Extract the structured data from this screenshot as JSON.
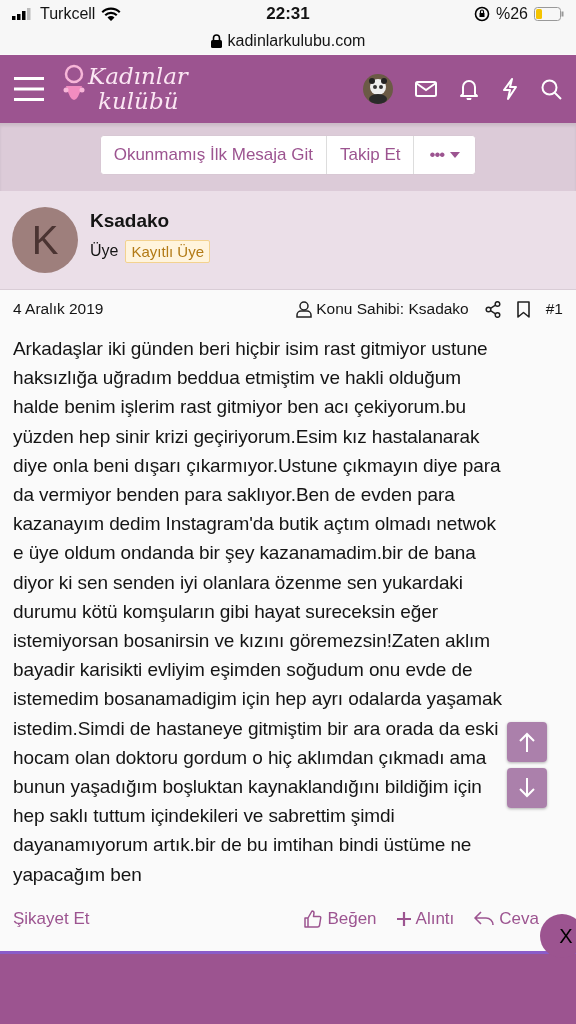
{
  "status_bar": {
    "carrier": "Turkcell",
    "time": "22:31",
    "battery": "%26"
  },
  "browser": {
    "url": "kadinlarkulubu.com"
  },
  "header": {
    "logo_top": "Kadınlar",
    "logo_bottom": "kulübü"
  },
  "thread_buttons": [
    {
      "kind": "text",
      "label": "Okunmamış İlk Mesaja Git"
    },
    {
      "kind": "text",
      "label": "Takip Et"
    },
    {
      "kind": "menu",
      "label": "•••"
    }
  ],
  "post": {
    "avatar_letter": "K",
    "username": "Ksadako",
    "role": "Üye",
    "badge": "Kayıtlı Üye",
    "date": "4 Aralık 2019",
    "owner": "Konu Sahibi: Ksadako",
    "number": "#1",
    "body": "Arkadaşlar iki günden beri hiçbir isim rast gitmiyor ustune haksızlığa uğradım beddua etmiştim ve hakli olduğum halde benim işlerim rast gitmiyor ben acı çekiyorum.bu yüzden hep sinir krizi geçiriyorum.Esim kız hastalanarak diye onla beni dışarı çıkarmıyor.Ustune çıkmayın diye para da vermiyor benden para saklıyor.Ben de evden para kazanayım dedim Instagram'da butik açtım olmadı netwok e üye oldum ondanda bir şey kazanamadim.bir de bana diyor ki sen senden iyi olanlara özenme sen yukardaki durumu kötü komşuların gibi hayat sureceksin eğer istemiyorsan bosanirsin ve kızını göremezsin!Zaten aklım bayadir karisikti evliyim eşimden soğudum onu evde de istemedim bosanamadigim için hep ayrı odalarda yaşamak istedim.Simdi de hastaneye gitmiştim bir ara orada da eski hocam olan doktoru gordum o hiç aklımdan çıkmadı ama bunun yaşadığım boşluktan kaynaklandığını bildiğim için hep saklı tuttum içindekileri ve sabrettim şimdi dayanamıyorum artık.bir de bu imtihan bindi üstüme ne yapacağım ben",
    "report": "Şikayet Et",
    "actions": [
      {
        "kind": "like",
        "label": "Beğen"
      },
      {
        "kind": "quote",
        "label": "Alıntı"
      },
      {
        "kind": "reply",
        "label": "Ceva"
      }
    ]
  },
  "close_label": "X"
}
